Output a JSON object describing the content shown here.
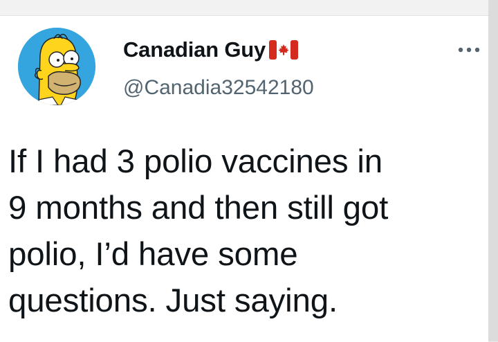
{
  "tweet": {
    "author": {
      "display_name": "Canadian Guy",
      "handle": "@Canadia32542180",
      "avatar_icon": "homer-simpson-avatar-icon",
      "badge_icon": "canada-flag-icon"
    },
    "text": "If I had 3 polio vaccines in\n9 months and then still got\npolio, I’d have some\nquestions. Just saying.",
    "more_icon": "more-options-icon"
  },
  "colors": {
    "avatar_bg": "#35a5df",
    "name": "#0f1419",
    "handle": "#536471",
    "flag_red": "#d52b1e"
  }
}
